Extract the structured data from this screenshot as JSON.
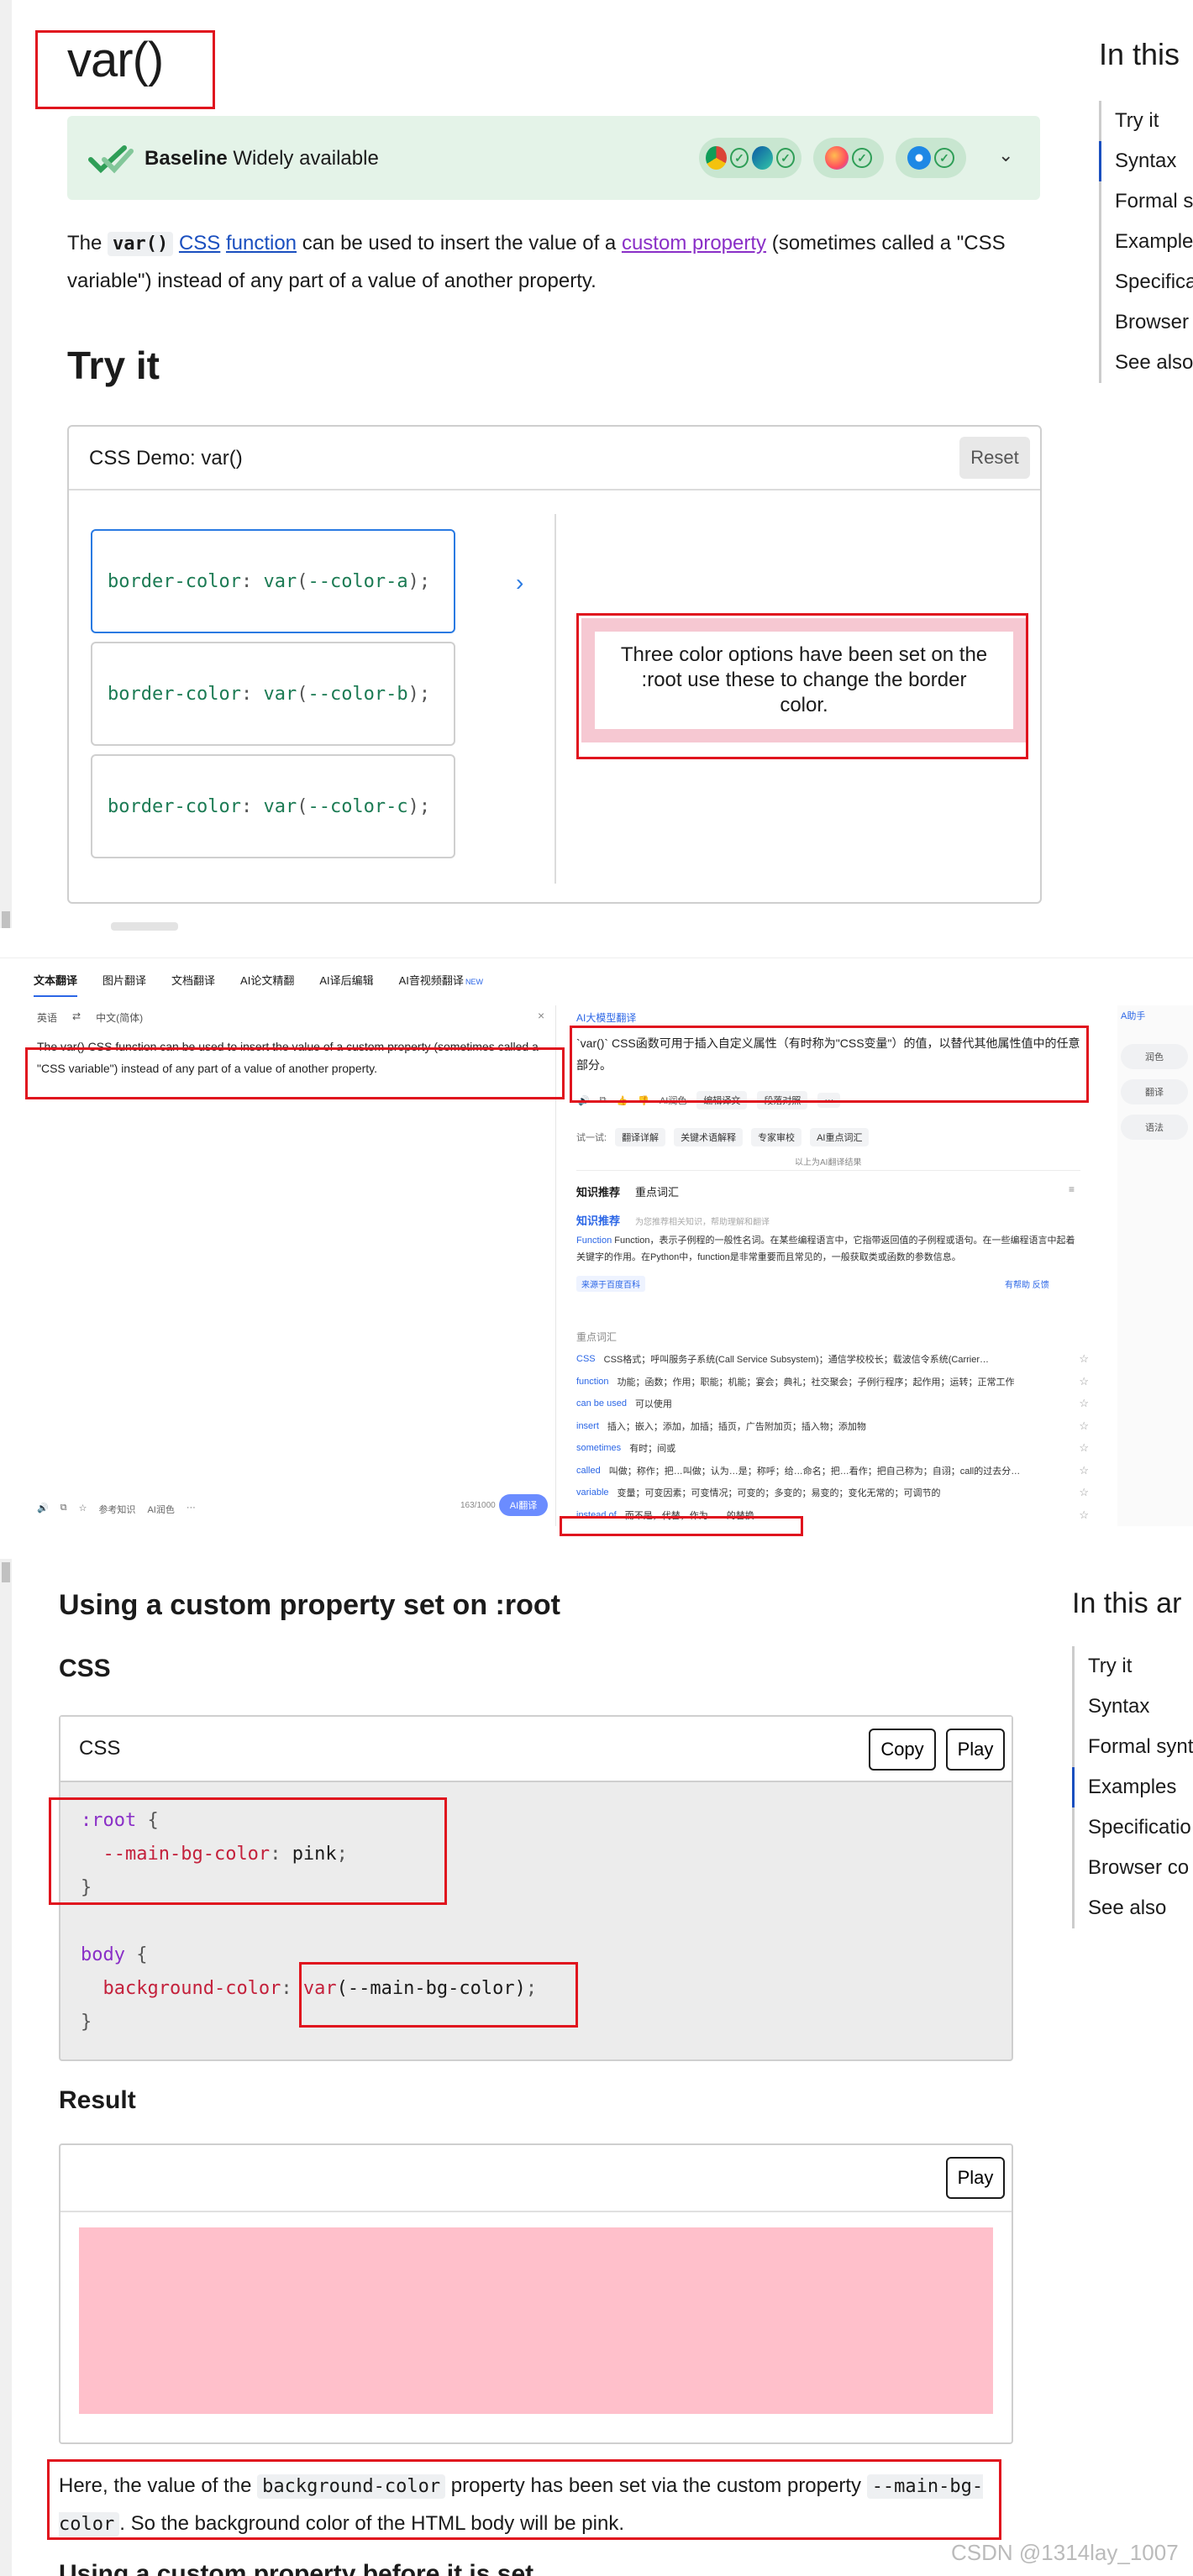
{
  "panel1": {
    "title": "var()",
    "baseline_bold": "Baseline",
    "baseline_rest": "Widely available",
    "desc": {
      "t1": "The ",
      "code": "var()",
      "t2": " ",
      "link_css": "CSS",
      "t3": " ",
      "link_function": "function",
      "t4": " can be used to insert the value of a ",
      "link_custom": "custom property",
      "t5": " (sometimes called a \"CSS variable\") instead of any part of a value of another property."
    },
    "tryit_heading": "Try it",
    "demo": {
      "title": "CSS Demo: var()",
      "reset_label": "Reset",
      "choices": [
        {
          "prop": "border-color",
          "fn": "var",
          "arg": "--color-a"
        },
        {
          "prop": "border-color",
          "fn": "var",
          "arg": "--color-b"
        },
        {
          "prop": "border-color",
          "fn": "var",
          "arg": "--color-c"
        }
      ],
      "arrow": "›",
      "output_text": "Three color options have been set on the :root use these to change the border color."
    },
    "toc_title": "In this",
    "toc": [
      "Try it",
      "Syntax",
      "Formal s",
      "Example",
      "Specifica",
      "Browser",
      "See also"
    ]
  },
  "panel2": {
    "tabs": [
      "文本翻译",
      "图片翻译",
      "文档翻译",
      "AI论文精翻",
      "AI译后编辑",
      "AI音视频翻译"
    ],
    "new_badge": "NEW",
    "lang_src": "英语",
    "lang_swap": "⇄",
    "lang_tgt": "中文(简体)",
    "close": "×",
    "source_text": "The var() CSS function can be used to insert the value of a custom property (sometimes called a \"CSS variable\") instead of any part of a value of another property.",
    "left_tools": [
      "🔊",
      "⧉",
      "☆",
      "参考知识",
      "AI润色",
      "···"
    ],
    "counter": "163/1000",
    "ai_btn": "AI翻译",
    "model": "AI大模型翻译",
    "target_text": "`var()` CSS函数可用于插入自定义属性（有时称为\"CSS变量\"）的值，以替代其他属性值中的任意部分。",
    "target_tools": [
      "🔊",
      "⧉",
      "👍",
      "👎",
      "AI润色",
      "编辑译文",
      "段落对照",
      "···"
    ],
    "try_label": "试一试:",
    "try_chips": [
      "翻译详解",
      "关键术语解释",
      "专家审校",
      "AI重点词汇"
    ],
    "ai_above": "以上为AI翻译结果",
    "know_tabs": [
      "知识推荐",
      "重点词汇"
    ],
    "know_menu": "≡",
    "know_sub": "知识推荐",
    "know_subhint": "为您推荐相关知识，帮助理解和翻译",
    "know_term": "Function",
    "know_body": "Function，表示子例程的一般性名词。在某些编程语言中，它指带返回值的子例程或语句。在一些编程语言中起着关键字的作用。在Python中，function是非常重要而且常见的，一般获取类或函数的参数信息。",
    "know_src": "来源于百度百科",
    "know_fb": "有帮助   反馈",
    "vocab_title": "重点词汇",
    "vocab": [
      {
        "w": "CSS",
        "d": "CSS格式；呼叫服务子系统(Call Service Subsystem)；通信学校校长；载波信令系统(Carrier…"
      },
      {
        "w": "function",
        "d": "功能；函数；作用；职能；机能；宴会；典礼；社交聚会；子例行程序；起作用；运转；正常工作"
      },
      {
        "w": "can be used",
        "d": "可以使用"
      },
      {
        "w": "insert",
        "d": "插入；嵌入；添加，加插；插页，广告附加页；插入物；添加物"
      },
      {
        "w": "sometimes",
        "d": "有时；间或"
      },
      {
        "w": "called",
        "d": "叫做；称作；把…叫做；认为…是；称呼；给…命名；把…看作；把自己称为；自诩；call的过去分…"
      },
      {
        "w": "variable",
        "d": "变量；可变因素；可变情况；可变的；多变的；易变的；变化无常的；可调节的"
      },
      {
        "w": "instead of",
        "d": "而不是，代替，作为……的替换"
      }
    ],
    "star": "☆",
    "assist": "A助手",
    "side_buttons": [
      "润色",
      "翻译",
      "语法"
    ]
  },
  "panel3": {
    "heading": "Using a custom property set on :root",
    "css_label": "CSS",
    "box_label": "CSS",
    "copy_label": "Copy",
    "play_label": "Play",
    "code": {
      "sel1": ":root",
      "ob": " {",
      "p1": "--main-bg-color",
      "v1": "pink",
      "cb": "}",
      "sel2": "body",
      "p2": "background-color",
      "fn": "var",
      "arg": "(--main-bg-color)",
      "semi": ";"
    },
    "result_label": "Result",
    "result_play": "Play",
    "note": {
      "t1": "Here, the value of the ",
      "c1": "background-color",
      "t2": " property has been set via the custom property ",
      "c2": "--main-bg-color",
      "t3": ". So the background color of the HTML body will be pink."
    },
    "next_heading": "Using a custom property before it is set",
    "toc_title": "In this ar",
    "toc": [
      "Try it",
      "Syntax",
      "Formal synt",
      "Examples",
      "Specificatio",
      "Browser co",
      "See also"
    ],
    "watermark": "CSDN @1314lay_1007"
  },
  "colors": {
    "accent": "#1a4fbf",
    "highlight": "#e0141e",
    "pink": "#ffc0cb",
    "baseline_bg": "#e4f3e8"
  }
}
